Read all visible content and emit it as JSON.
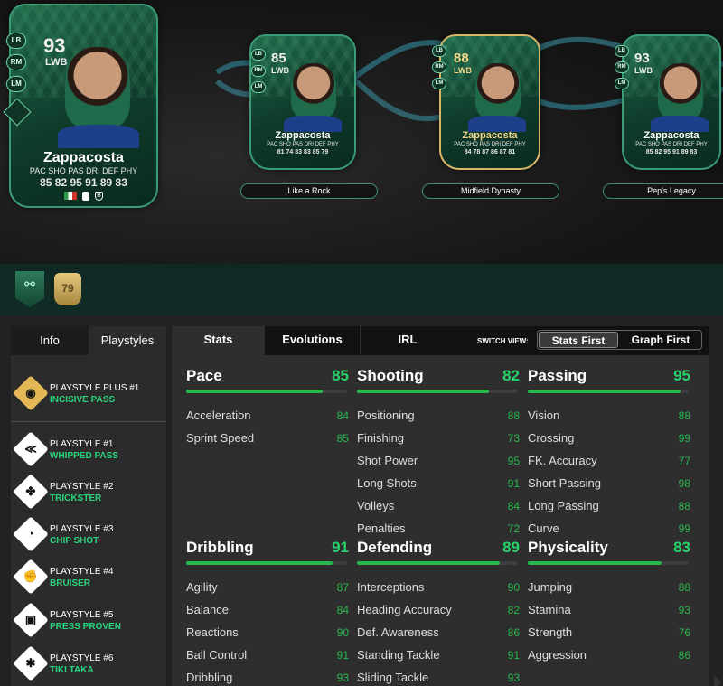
{
  "main_card": {
    "rating": "93",
    "position": "LWB",
    "name": "Zappacosta",
    "alt_positions": [
      "LB",
      "RM",
      "LM"
    ],
    "stat_labels": "PAC SHO PAS DRI DEF PHY",
    "stat_values": "85 82 95 91 89 83"
  },
  "evo_cards": [
    {
      "rating": "85",
      "position": "LWB",
      "name": "Zappacosta",
      "stat_labels": "PAC SHO PAS DRI DEF PHY",
      "stat_values": "81 74 83 83 85 79",
      "label": "Like a Rock",
      "alt_positions": [
        "LB",
        "RM",
        "LM"
      ]
    },
    {
      "rating": "88",
      "position": "LWB",
      "name": "Zappacosta",
      "stat_labels": "PAC SHO PAS DRI DEF PHY",
      "stat_values": "84 78 87 86 87 81",
      "label": "Midfield Dynasty",
      "alt_positions": [
        "LB",
        "RM",
        "LM"
      ]
    },
    {
      "rating": "93",
      "position": "LWB",
      "name": "Zappacosta",
      "stat_labels": "PAC SHO PAS DRI DEF PHY",
      "stat_values": "85 82 95 91 89 83",
      "label": "Pep's Legacy",
      "alt_positions": [
        "LB",
        "RM",
        "LM"
      ]
    }
  ],
  "strip": {
    "gold_rating": "79"
  },
  "left_tabs": {
    "info": "Info",
    "playstyles": "Playstyles"
  },
  "playstyles": [
    {
      "title": "PLAYSTYLE PLUS #1",
      "name": "INCISIVE PASS",
      "glyph": "◉",
      "icon": "incisive-pass-icon"
    },
    {
      "title": "PLAYSTYLE #1",
      "name": "WHIPPED PASS",
      "glyph": "≪",
      "icon": "whipped-pass-icon"
    },
    {
      "title": "PLAYSTYLE #2",
      "name": "TRICKSTER",
      "glyph": "✤",
      "icon": "trickster-icon"
    },
    {
      "title": "PLAYSTYLE #3",
      "name": "CHIP SHOT",
      "glyph": "◔",
      "icon": "chip-shot-icon"
    },
    {
      "title": "PLAYSTYLE #4",
      "name": "BRUISER",
      "glyph": "✊",
      "icon": "bruiser-icon"
    },
    {
      "title": "PLAYSTYLE #5",
      "name": "PRESS PROVEN",
      "glyph": "▣",
      "icon": "press-proven-icon"
    },
    {
      "title": "PLAYSTYLE #6",
      "name": "TIKI TAKA",
      "glyph": "✱",
      "icon": "tiki-taka-icon"
    }
  ],
  "right_tabs": {
    "stats": "Stats",
    "evolutions": "Evolutions",
    "irl": "IRL"
  },
  "switch_view": {
    "label": "SWITCH VIEW:",
    "stats_first": "Stats First",
    "graph_first": "Graph First"
  },
  "stat_groups": [
    {
      "name": "Pace",
      "value": "85",
      "rows": [
        [
          "Acceleration",
          "84"
        ],
        [
          "Sprint Speed",
          "85"
        ]
      ]
    },
    {
      "name": "Shooting",
      "value": "82",
      "rows": [
        [
          "Positioning",
          "88"
        ],
        [
          "Finishing",
          "73"
        ],
        [
          "Shot Power",
          "95"
        ],
        [
          "Long Shots",
          "91"
        ],
        [
          "Volleys",
          "84"
        ],
        [
          "Penalties",
          "72"
        ]
      ]
    },
    {
      "name": "Passing",
      "value": "95",
      "rows": [
        [
          "Vision",
          "88"
        ],
        [
          "Crossing",
          "99"
        ],
        [
          "FK. Accuracy",
          "77"
        ],
        [
          "Short Passing",
          "98"
        ],
        [
          "Long Passing",
          "88"
        ],
        [
          "Curve",
          "99"
        ]
      ]
    },
    {
      "name": "Dribbling",
      "value": "91",
      "rows": [
        [
          "Agility",
          "87"
        ],
        [
          "Balance",
          "84"
        ],
        [
          "Reactions",
          "90"
        ],
        [
          "Ball Control",
          "91"
        ],
        [
          "Dribbling",
          "93"
        ]
      ]
    },
    {
      "name": "Defending",
      "value": "89",
      "rows": [
        [
          "Interceptions",
          "90"
        ],
        [
          "Heading Accuracy",
          "82"
        ],
        [
          "Def. Awareness",
          "86"
        ],
        [
          "Standing Tackle",
          "91"
        ],
        [
          "Sliding Tackle",
          "93"
        ]
      ]
    },
    {
      "name": "Physicality",
      "value": "83",
      "rows": [
        [
          "Jumping",
          "88"
        ],
        [
          "Stamina",
          "93"
        ],
        [
          "Strength",
          "76"
        ],
        [
          "Aggression",
          "86"
        ]
      ]
    }
  ],
  "colors": {
    "accent_green": "#28d36b",
    "bar_green": "#27b84d",
    "card_border": "#3a9c76",
    "gold": "#d7b66a"
  }
}
